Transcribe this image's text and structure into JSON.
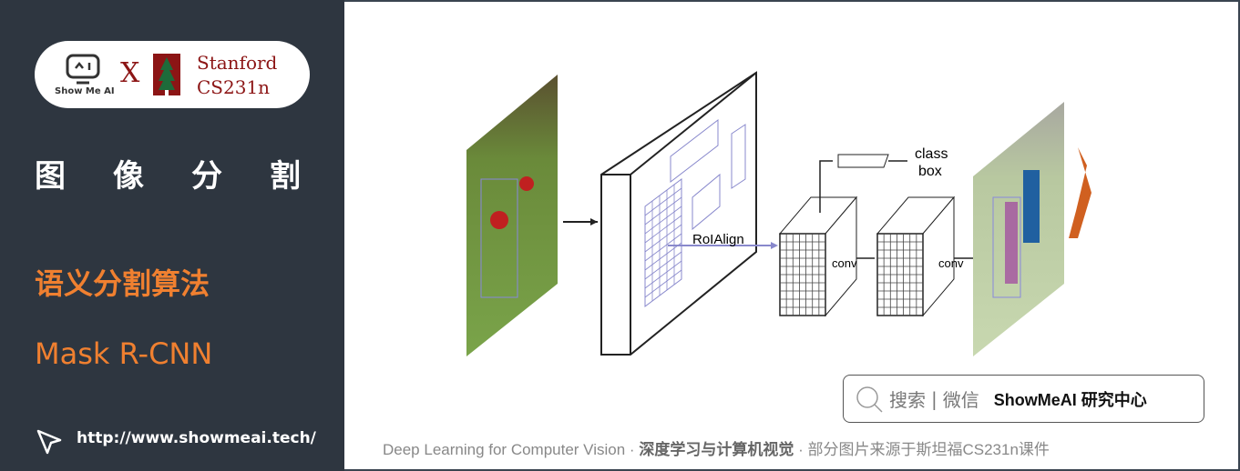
{
  "sidebar": {
    "logo_showme": "Show Me AI",
    "logo_x": "X",
    "logo_stanford_1": "Stanford",
    "logo_stanford_2": "CS231n",
    "title": "图像分割",
    "subtitle": "语义分割算法",
    "topic": "Mask R-CNN",
    "url": "http://www.showmeai.tech/"
  },
  "diagram": {
    "roialign": "RoIAlign",
    "class": "class",
    "box": "box",
    "conv1": "conv",
    "conv2": "conv"
  },
  "search": {
    "label": "搜索",
    "sep": "|",
    "wechat": "微信",
    "brand": "ShowMeAI 研究中心"
  },
  "footer": {
    "part1": "Deep Learning for Computer Vision",
    "dot": "·",
    "part2": "深度学习与计算机视觉",
    "part3": "部分图片来源于斯坦福CS231n课件"
  },
  "colors": {
    "sidebar_bg": "#2e3640",
    "accent": "#f08030",
    "stanford": "#8c1515"
  }
}
